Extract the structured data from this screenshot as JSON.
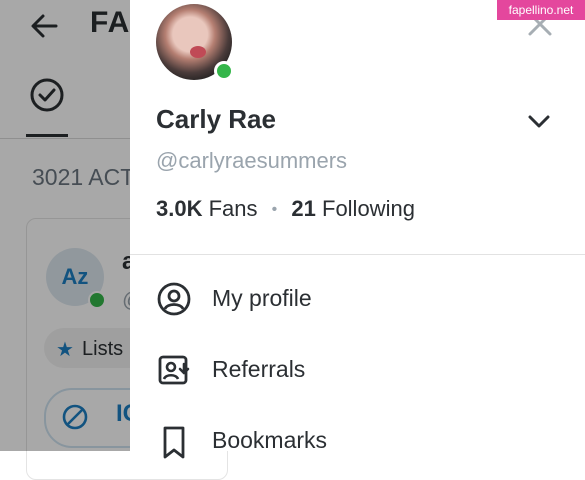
{
  "background": {
    "title": "FA",
    "count_text": "3021 ACT",
    "card": {
      "avatar_initials": "Az",
      "name_fragment": "a",
      "handle_fragment": "@",
      "lists_label": "Lists",
      "block_label_fragment": "IC"
    }
  },
  "drawer": {
    "display_name": "Carly Rae",
    "handle": "@carlyraesummers",
    "stats": {
      "fans_count": "3.0K",
      "fans_label": "Fans",
      "separator": "•",
      "following_count": "21",
      "following_label": "Following"
    },
    "menu": [
      {
        "label": "My profile",
        "icon": "profile-icon"
      },
      {
        "label": "Referrals",
        "icon": "referrals-icon"
      },
      {
        "label": "Bookmarks",
        "icon": "bookmark-icon"
      }
    ]
  },
  "watermark": "fapellino.net",
  "colors": {
    "accent": "#1c7fc2",
    "online": "#35b64a",
    "watermark_bg": "#e4479d"
  }
}
